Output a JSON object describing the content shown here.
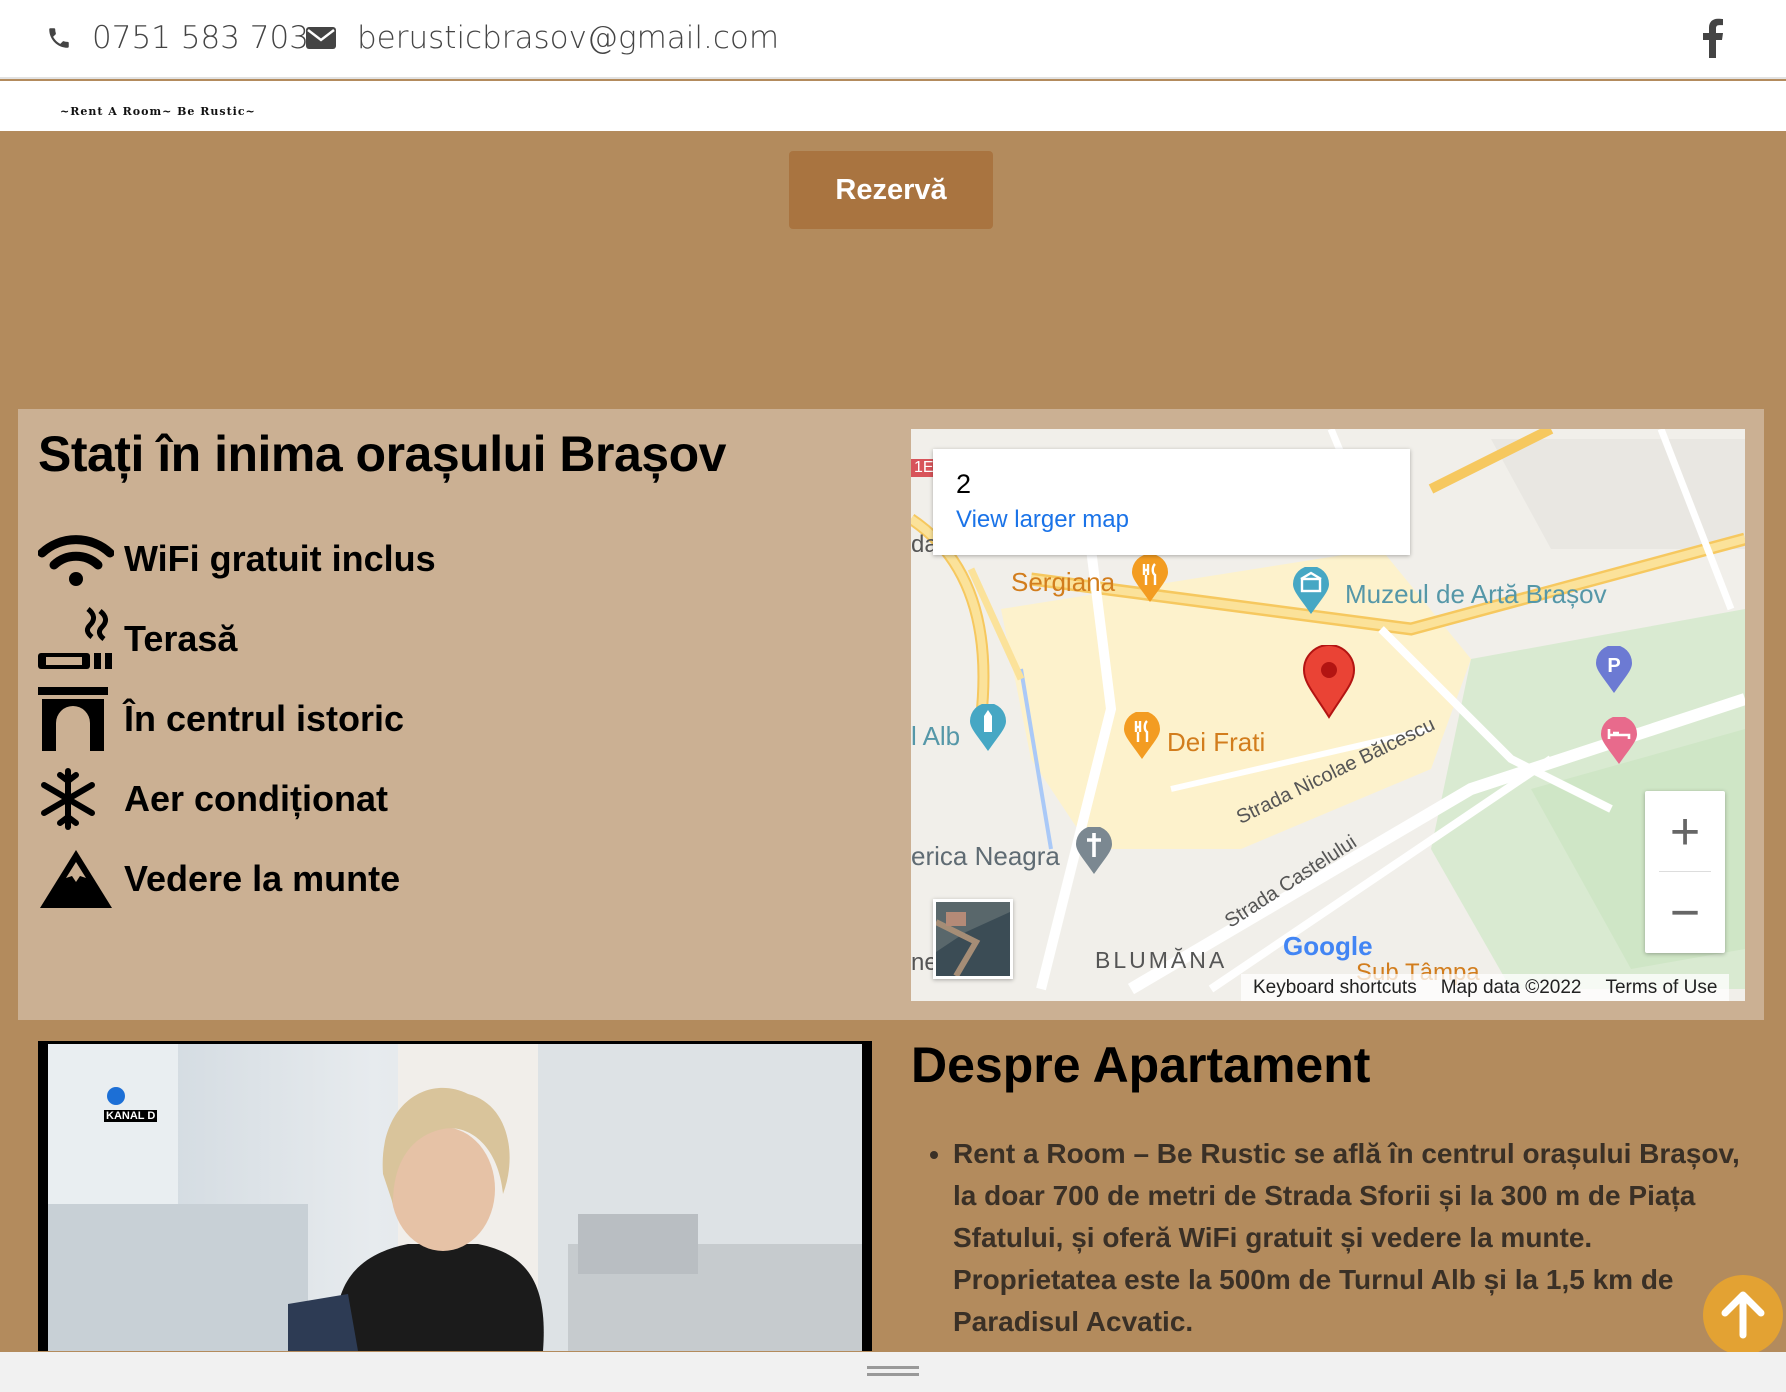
{
  "topbar": {
    "phone": "0751 583 703",
    "email": "berusticbrasov@gmail.com",
    "social_icon": "facebook-icon"
  },
  "logo": {
    "text": "~Rent A Room~ Be Rustic~"
  },
  "reserve": {
    "label": "Rezervă"
  },
  "features": {
    "title": "Stați în inima orașului Brașov",
    "items": [
      {
        "icon": "wifi-icon",
        "label": "WiFi gratuit inclus"
      },
      {
        "icon": "smoking-terrace-icon",
        "label": "Terasă"
      },
      {
        "icon": "archway-icon",
        "label": "În centrul istoric"
      },
      {
        "icon": "snowflake-icon",
        "label": "Aer condiționat"
      },
      {
        "icon": "mountain-icon",
        "label": "Vedere la munte"
      }
    ]
  },
  "map": {
    "card_number": "2",
    "larger_map_link": "View larger map",
    "labels": {
      "sergiana": "Sergiana",
      "muzeul": "Muzeul de Artă Brașov",
      "dei_frati": "Dei Frati",
      "alb": "l Alb",
      "biserica": "erica Neagra",
      "balcescu": "Strada Nicolae Bălcescu",
      "castelului": "Strada Castelului",
      "blumana": "BLUMĂNA",
      "sub_tampa": "Sub Tâmpa",
      "google": "Google",
      "road_tag": "1E",
      "edge_da": "da",
      "edge_ne": "ne"
    },
    "footer": {
      "keyboard": "Keyboard shortcuts",
      "mapdata": "Map data ©2022",
      "terms": "Terms of Use"
    },
    "zoom_in": "+",
    "zoom_out": "−"
  },
  "video": {
    "channel": "KANAL D"
  },
  "about": {
    "title": "Despre Apartament",
    "paragraph": "Rent a Room – Be Rustic se află în centrul orașului Brașov, la doar 700 de metri de Strada Sforii și la 300 m de Piața Sfatului, și oferă WiFi gratuit și vedere la munte. Proprietatea este la 500m de Turnul Alb și la 1,5 km de Paradisul Acvatic."
  },
  "colors": {
    "page_bg": "#b38b5d",
    "panel_bg": "#cbb093",
    "button_bg": "#a97440",
    "scroll_btn": "#e3a233"
  }
}
